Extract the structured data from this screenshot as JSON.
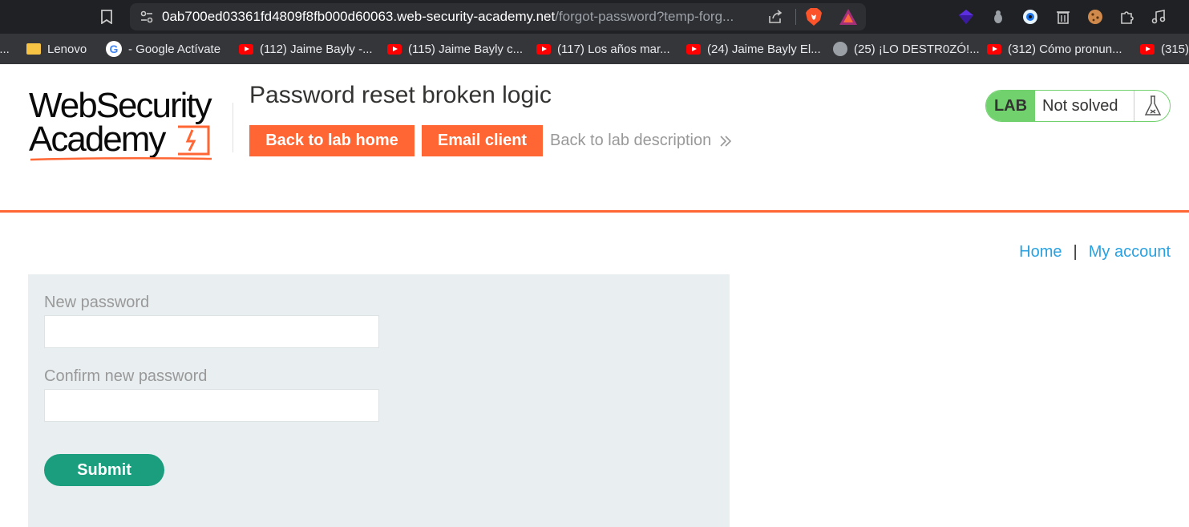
{
  "browser": {
    "url_host": "0ab700ed03361fd4809f8fb000d60063.web-security-academy.net",
    "url_path": "/forgot-password?temp-forg...",
    "bookmarks": [
      {
        "label": "l...",
        "icon": "partial-icon"
      },
      {
        "label": "Lenovo",
        "icon": "folder-icon"
      },
      {
        "label": "- Google Actívate",
        "icon": "google-icon"
      },
      {
        "label": "(112) Jaime Bayly -...",
        "icon": "youtube-icon"
      },
      {
        "label": "(115) Jaime Bayly c...",
        "icon": "youtube-icon"
      },
      {
        "label": "(117) Los años mar...",
        "icon": "youtube-icon"
      },
      {
        "label": "(24) Jaime Bayly El...",
        "icon": "youtube-icon"
      },
      {
        "label": "(25) ¡LO DESTR0ZÓ!...",
        "icon": "globe-icon"
      },
      {
        "label": "(312) Cómo pronun...",
        "icon": "youtube-icon"
      },
      {
        "label": "(315)",
        "icon": "youtube-icon"
      }
    ]
  },
  "header": {
    "logo_line1": "WebSecurity",
    "logo_line2": "Academy",
    "lab_title": "Password reset broken logic",
    "back_to_lab_home": "Back to lab home",
    "email_client": "Email client",
    "back_to_lab_description": "Back to lab description",
    "status_tag": "LAB",
    "status_text": "Not solved"
  },
  "nav": {
    "home": "Home",
    "separator": "|",
    "my_account": "My account"
  },
  "form": {
    "new_password_label": "New password",
    "new_password_value": "",
    "confirm_password_label": "Confirm new password",
    "confirm_password_value": "",
    "submit_label": "Submit"
  },
  "colors": {
    "accent_orange": "#ff6633",
    "lab_green": "#70d16d",
    "submit_green": "#1a9e7e",
    "link_blue": "#29a1e0",
    "panel_bg": "#e9eef0"
  }
}
